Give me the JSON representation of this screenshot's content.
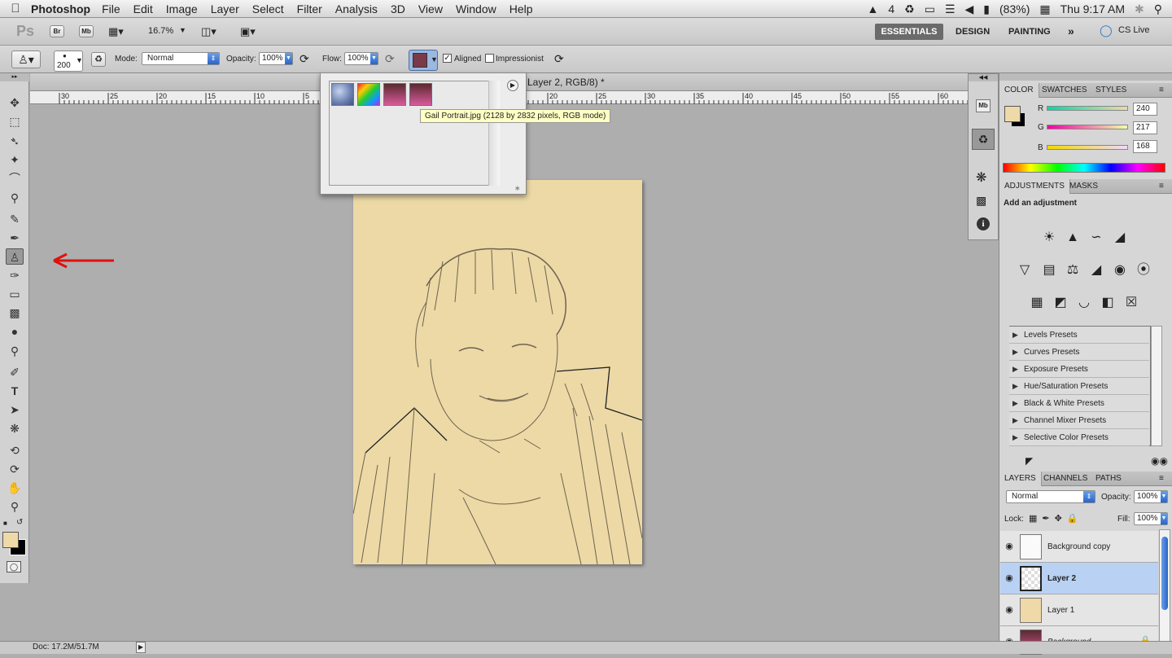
{
  "menubar": {
    "apple": "",
    "app": "Photoshop",
    "items": [
      "File",
      "Edit",
      "Image",
      "Layer",
      "Select",
      "Filter",
      "Analysis",
      "3D",
      "View",
      "Window",
      "Help"
    ],
    "status": {
      "adobe": "4",
      "battery": "(83%)",
      "time": "Thu 9:17 AM"
    }
  },
  "appbar": {
    "ps": "Ps",
    "br": "Br",
    "mb": "Mb",
    "zoom": "16.7%",
    "workspaces": [
      "ESSENTIALS",
      "DESIGN",
      "PAINTING"
    ],
    "cslive": "CS Live"
  },
  "options": {
    "brush_size": "200",
    "mode_label": "Mode:",
    "mode_value": "Normal",
    "opacity_label": "Opacity:",
    "opacity_value": "100%",
    "flow_label": "Flow:",
    "flow_value": "100%",
    "aligned": "Aligned",
    "impressionist": "Impressionist"
  },
  "document": {
    "title": "Layer 2, RGB/8) *",
    "ruler_ticks": [
      "30",
      "25",
      "20",
      "15",
      "10",
      "5",
      "20",
      "25",
      "30",
      "35",
      "40",
      "45",
      "50",
      "55",
      "60"
    ]
  },
  "picker": {
    "tooltip": "Gail Portrait.jpg (2128 by 2832 pixels, RGB mode)"
  },
  "status": {
    "doc": "Doc: 17.2M/51.7M"
  },
  "color_panel": {
    "tabs": [
      "COLOR",
      "SWATCHES",
      "STYLES"
    ],
    "r_label": "R",
    "g_label": "G",
    "b_label": "B",
    "r": "240",
    "g": "217",
    "b": "168",
    "fg_color": "#f0d9a8"
  },
  "adjust_panel": {
    "tabs": [
      "ADJUSTMENTS",
      "MASKS"
    ],
    "heading": "Add an adjustment",
    "presets": [
      "Levels Presets",
      "Curves Presets",
      "Exposure Presets",
      "Hue/Saturation Presets",
      "Black & White Presets",
      "Channel Mixer Presets",
      "Selective Color Presets"
    ]
  },
  "layers_panel": {
    "tabs": [
      "LAYERS",
      "CHANNELS",
      "PATHS"
    ],
    "blend": "Normal",
    "opacity_label": "Opacity:",
    "opacity": "100%",
    "lock_label": "Lock:",
    "fill_label": "Fill:",
    "fill": "100%",
    "layers": [
      "Background copy",
      "Layer 2",
      "Layer 1",
      "Background"
    ]
  }
}
